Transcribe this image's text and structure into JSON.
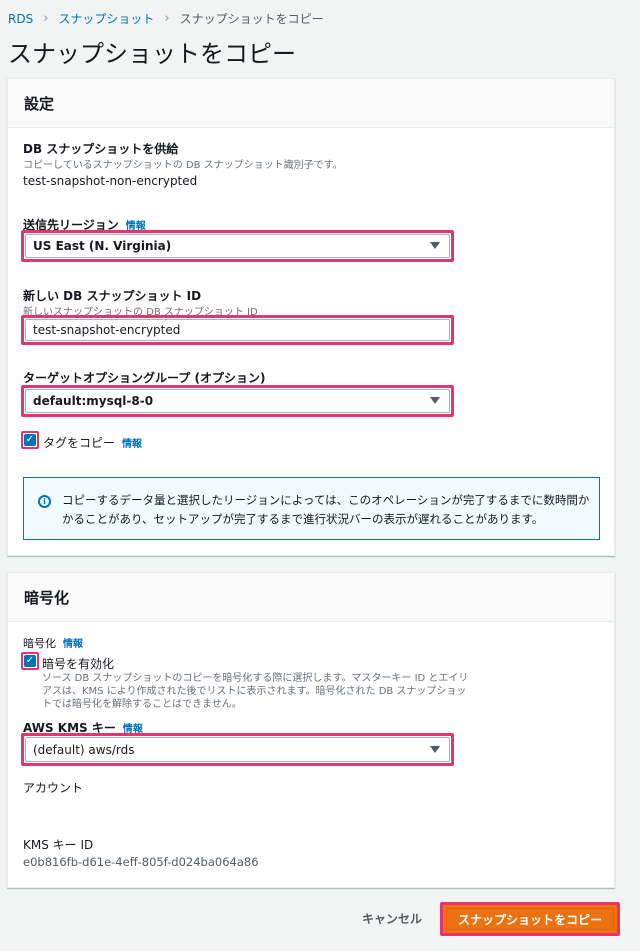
{
  "breadcrumb": {
    "items": [
      "RDS",
      "スナップショット"
    ],
    "current": "スナップショットをコピー"
  },
  "page_title": "スナップショットをコピー",
  "settings": {
    "header": "設定",
    "source_snapshot": {
      "label": "DB スナップショットを供給",
      "description": "コピーしているスナップショットの DB スナップショット識別子です。",
      "value": "test-snapshot-non-encrypted"
    },
    "destination_region": {
      "label": "送信先リージョン",
      "info": "情報",
      "value": "US East (N. Virginia)"
    },
    "new_snapshot_id": {
      "label": "新しい DB スナップショット ID",
      "description": "新しいスナップショットの DB スナップショット ID",
      "value": "test-snapshot-encrypted"
    },
    "option_group": {
      "label": "ターゲットオプショングループ (オプション)",
      "value": "default:mysql-8-0"
    },
    "copy_tags": {
      "label": "タグをコピー",
      "info": "情報",
      "checked": true
    },
    "alert_text": "コピーするデータ量と選択したリージョンによっては、このオペレーションが完了するまでに数時間かかることがあり、セットアップが完了するまで進行状況バーの表示が遅れることがあります。"
  },
  "encryption": {
    "header": "暗号化",
    "label": "暗号化",
    "info": "情報",
    "enable": {
      "label": "暗号を有効化",
      "checked": true,
      "description_lines": [
        "ソース DB スナップショットのコピーを暗号化する際に選択します。マスターキー ID とエイリ",
        "アスは、KMS により作成された後でリストに表示されます。暗号化された DB スナップショッ",
        "トでは暗号化を解除することはできません。"
      ]
    },
    "kms_key": {
      "label": "AWS KMS キー",
      "info": "情報",
      "value": "(default) aws/rds"
    },
    "account_label": "アカウント",
    "kms_key_id_label": "KMS キー ID",
    "kms_key_id_value": "e0b816fb-d61e-4eff-805f-d024ba064a86"
  },
  "actions": {
    "cancel": "キャンセル",
    "copy": "スナップショットをコピー"
  },
  "colors": {
    "highlight": "#e8336d",
    "primary": "#ec7211",
    "link": "#0073bb"
  }
}
